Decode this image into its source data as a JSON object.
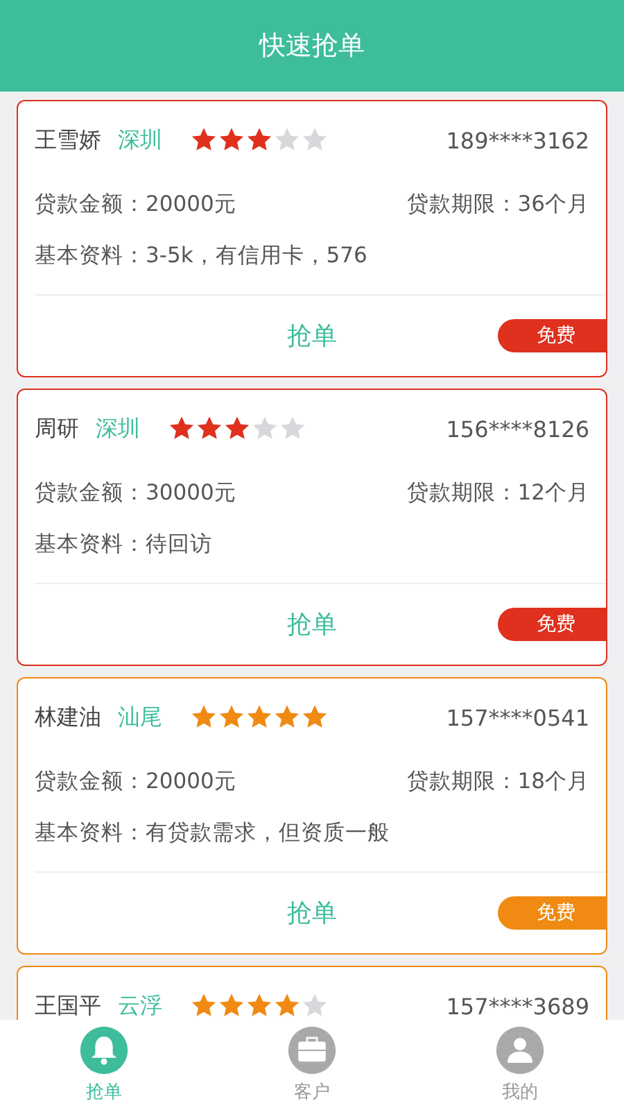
{
  "header": {
    "title": "快速抢单"
  },
  "orders": [
    {
      "name": "王雪娇",
      "city": "深圳",
      "stars": 3,
      "color": "#e0301e",
      "phone": "189****3162",
      "amount": "贷款金额：20000元",
      "term": "贷款期限：36个月",
      "info": "基本资料：3-5k，有信用卡，576",
      "action": "抢单",
      "badge": "免费"
    },
    {
      "name": "周研",
      "city": "深圳",
      "stars": 3,
      "color": "#e0301e",
      "phone": "156****8126",
      "amount": "贷款金额：30000元",
      "term": "贷款期限：12个月",
      "info": "基本资料：待回访",
      "action": "抢单",
      "badge": "免费"
    },
    {
      "name": "林建油",
      "city": "汕尾",
      "stars": 5,
      "color": "#f08a12",
      "phone": "157****0541",
      "amount": "贷款金额：20000元",
      "term": "贷款期限：18个月",
      "info": "基本资料：有贷款需求，但资质一般",
      "action": "抢单",
      "badge": "免费"
    },
    {
      "name": "王国平",
      "city": "云浮",
      "stars": 4,
      "color": "#f08a12",
      "phone": "157****3689"
    }
  ],
  "tabs": [
    {
      "label": "抢单",
      "kind": "bell",
      "selected": true
    },
    {
      "label": "客户",
      "kind": "case",
      "selected": false
    },
    {
      "label": "我的",
      "kind": "person",
      "selected": false
    }
  ]
}
